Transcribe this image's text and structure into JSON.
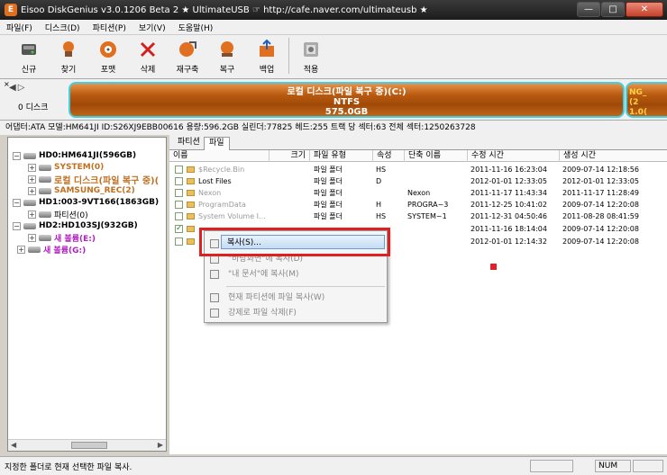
{
  "window": {
    "title": "Eisoo DiskGenius v3.0.1206 Beta 2  ★ UltimateUSB  ☞ http://cafe.naver.com/ultimateusb ★",
    "app_icon_letter": "E",
    "controls": {
      "minimize": "—",
      "maximize": "□",
      "close": "✕"
    }
  },
  "menu": [
    "파일(F)",
    "디스크(D)",
    "파티션(P)",
    "보기(V)",
    "도움말(H)"
  ],
  "toolbar": [
    {
      "label": "신규",
      "icon": "new-disk-icon"
    },
    {
      "label": "찾기",
      "icon": "search-icon"
    },
    {
      "label": "포맷",
      "icon": "format-icon"
    },
    {
      "label": "삭제",
      "icon": "delete-icon"
    },
    {
      "label": "재구축",
      "icon": "rebuild-icon"
    },
    {
      "label": "복구",
      "icon": "recover-icon"
    },
    {
      "label": "백업",
      "icon": "backup-icon"
    },
    {
      "label": "적용",
      "icon": "apply-icon"
    }
  ],
  "disk_nav": {
    "close": "×",
    "arrows": "◀▷",
    "label": "0 디스크"
  },
  "partition_bar": {
    "name": "로컬 디스크(파일 복구 중)(C:)",
    "fs": "NTFS",
    "size": "575.0GB",
    "next_partition_text": [
      "NG_",
      "(2",
      "1.0("
    ]
  },
  "disk_info": "어댑터:ATA  모델:HM641JI  ID:S26XJ9EBB00616  용량:596.2GB  실린더:77825  헤드:255  트랙 당 섹터:63  전체 섹터:1250263728",
  "tree": [
    {
      "text": "HD0:HM641JI(596GB)",
      "level": 0,
      "bold": true,
      "color": "#000"
    },
    {
      "text": "SYSTEM(0)",
      "level": 1,
      "bold": true,
      "color": "#c07020"
    },
    {
      "text": "로컬 디스크(파일 복구 중)(",
      "level": 1,
      "bold": true,
      "color": "#c07020"
    },
    {
      "text": "SAMSUNG_REC(2)",
      "level": 1,
      "bold": true,
      "color": "#c07020"
    },
    {
      "text": "HD1:003-9VT166(1863GB)",
      "level": 0,
      "bold": true,
      "color": "#000"
    },
    {
      "text": "파티션(0)",
      "level": 1,
      "bold": false,
      "color": "#000"
    },
    {
      "text": "HD2:HD103SJ(932GB)",
      "level": 0,
      "bold": true,
      "color": "#000"
    },
    {
      "text": "새 볼륨(E:)",
      "level": 1,
      "bold": true,
      "color": "#b020c0"
    },
    {
      "text": "새 볼륨(G:)",
      "level": 0.5,
      "bold": true,
      "color": "#b020c0"
    }
  ],
  "tabs": [
    "파티션",
    "파일"
  ],
  "columns": [
    "이름",
    "크기",
    "파일 유형",
    "속성",
    "단축 이름",
    "수정 시간",
    "생성 시간"
  ],
  "files": [
    {
      "name": "$Recycle.Bin",
      "size": "",
      "type": "파일 폴더",
      "attr": "HS",
      "short": "",
      "modified": "2011-11-16 16:23:04",
      "created": "2009-07-14 12:18:56",
      "gray": true,
      "checked": false
    },
    {
      "name": "Lost Files",
      "size": "",
      "type": "파일 폴더",
      "attr": "D",
      "short": "",
      "modified": "2012-01-01 12:33:05",
      "created": "2012-01-01 12:33:05",
      "gray": false,
      "checked": false
    },
    {
      "name": "Nexon",
      "size": "",
      "type": "파일 폴더",
      "attr": "",
      "short": "Nexon",
      "modified": "2011-11-17 11:43:34",
      "created": "2011-11-17 11:28:49",
      "gray": true,
      "checked": false
    },
    {
      "name": "ProgramData",
      "size": "",
      "type": "파일 폴더",
      "attr": "H",
      "short": "PROGRA~3",
      "modified": "2011-12-25 10:41:02",
      "created": "2009-07-14 12:20:08",
      "gray": true,
      "checked": false
    },
    {
      "name": "System Volume I...",
      "size": "",
      "type": "파일 폴더",
      "attr": "HS",
      "short": "SYSTEM~1",
      "modified": "2011-12-31 04:50:46",
      "created": "2011-08-28 08:41:59",
      "gray": true,
      "checked": false
    },
    {
      "name": "",
      "size": "",
      "type": "",
      "attr": "",
      "short": "",
      "modified": "2011-11-16 18:14:04",
      "created": "2009-07-14 12:20:08",
      "gray": false,
      "checked": true
    },
    {
      "name": "",
      "size": "",
      "type": "",
      "attr": "",
      "short": "",
      "modified": "2012-01-01 12:14:32",
      "created": "2009-07-14 12:20:08",
      "gray": false,
      "checked": false
    }
  ],
  "context_menu": [
    {
      "label": "복사(S)...",
      "enabled": true,
      "selected": true,
      "icon": "copy-icon"
    },
    {
      "label": "\"바탕화면\"에 복사(D)",
      "enabled": false,
      "selected": false,
      "icon": "desktop-copy-icon"
    },
    {
      "label": "\"내 문서\"에 복사(M)",
      "enabled": false,
      "selected": false,
      "icon": "documents-copy-icon"
    },
    {
      "label": "현재 파티션에 파일 복사(W)",
      "enabled": false,
      "selected": false,
      "icon": "partition-copy-icon"
    },
    {
      "label": "강제로 파일 삭제(F)",
      "enabled": false,
      "selected": false,
      "icon": "force-delete-icon"
    }
  ],
  "status": {
    "text": "지정한 폴더로 현재 선택한 파일 복사.",
    "num": "NUM"
  },
  "colors": {
    "partition_fill": "#b85a10",
    "partition_border": "#3fd0e6",
    "highlight": "#e02020",
    "tree_orange": "#c07020",
    "tree_purple": "#b020c0"
  }
}
